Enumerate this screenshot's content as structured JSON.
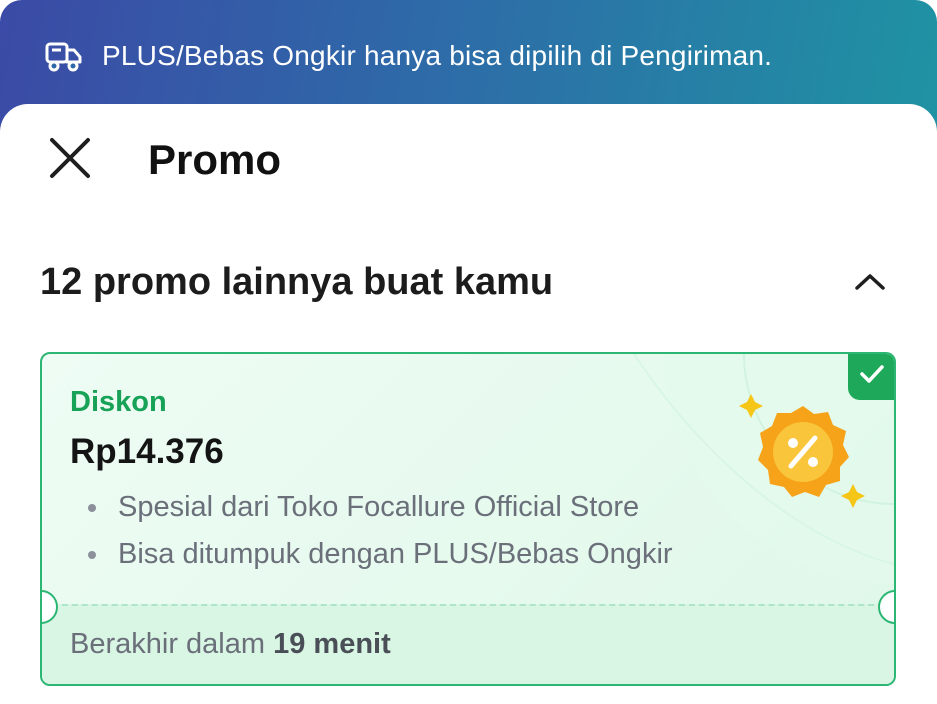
{
  "banner": {
    "icon": "delivery-truck-icon",
    "text": "PLUS/Bebas Ongkir hanya bisa dipilih di Pengiriman."
  },
  "header": {
    "close_icon": "close-icon",
    "title": "Promo"
  },
  "section": {
    "title": "12 promo lainnya buat kamu",
    "toggle_icon": "chevron-up-icon"
  },
  "promo_card": {
    "type": "Diskon",
    "amount": "Rp14.376",
    "bullets": [
      "Spesial dari Toko Focallure Official Store",
      "Bisa ditumpuk dengan PLUS/Bebas Ongkir"
    ],
    "expiry_prefix": "Berakhir dalam",
    "expiry_value": "19 menit",
    "selected": true,
    "badge_icon": "percent-badge-icon",
    "check_icon": "check-icon"
  },
  "colors": {
    "accent_green": "#17a257",
    "card_border": "#2bb673",
    "banner_start": "#3b4aa6",
    "banner_end": "#1f93a3"
  }
}
